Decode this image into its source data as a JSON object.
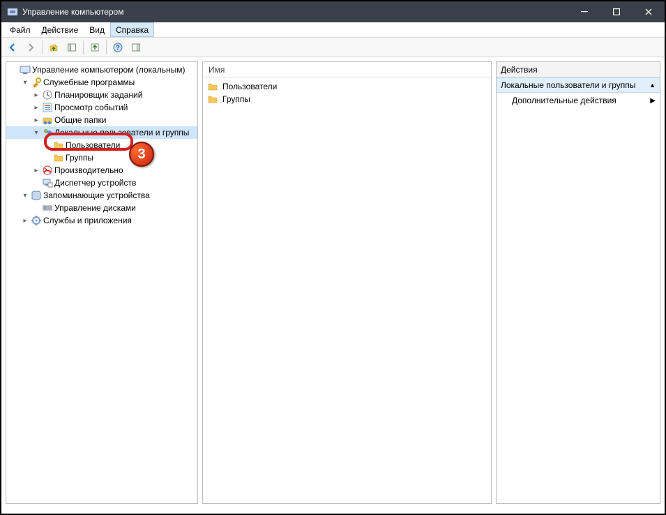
{
  "window": {
    "title": "Управление компьютером"
  },
  "menu": {
    "file": "Файл",
    "action": "Действие",
    "view": "Вид",
    "help": "Справка"
  },
  "tree": {
    "root": "Управление компьютером (локальным)",
    "system_tools": "Служебные программы",
    "scheduler": "Планировщик заданий",
    "event_viewer": "Просмотр событий",
    "shared_folders": "Общие папки",
    "local_users_groups": "Локальные пользователи и группы",
    "users": "Пользователи",
    "groups": "Группы",
    "performance": "Производительно",
    "device_manager": "Диспетчер устройств",
    "storage": "Запоминающие устройства",
    "disk_mgmt": "Управление дисками",
    "services_apps": "Службы и приложения"
  },
  "list": {
    "header_name": "Имя",
    "items": [
      {
        "label": "Пользователи"
      },
      {
        "label": "Группы"
      }
    ]
  },
  "actions": {
    "title": "Действия",
    "section": "Локальные пользователи и группы",
    "more": "Дополнительные действия"
  },
  "callout": {
    "number": "3"
  }
}
